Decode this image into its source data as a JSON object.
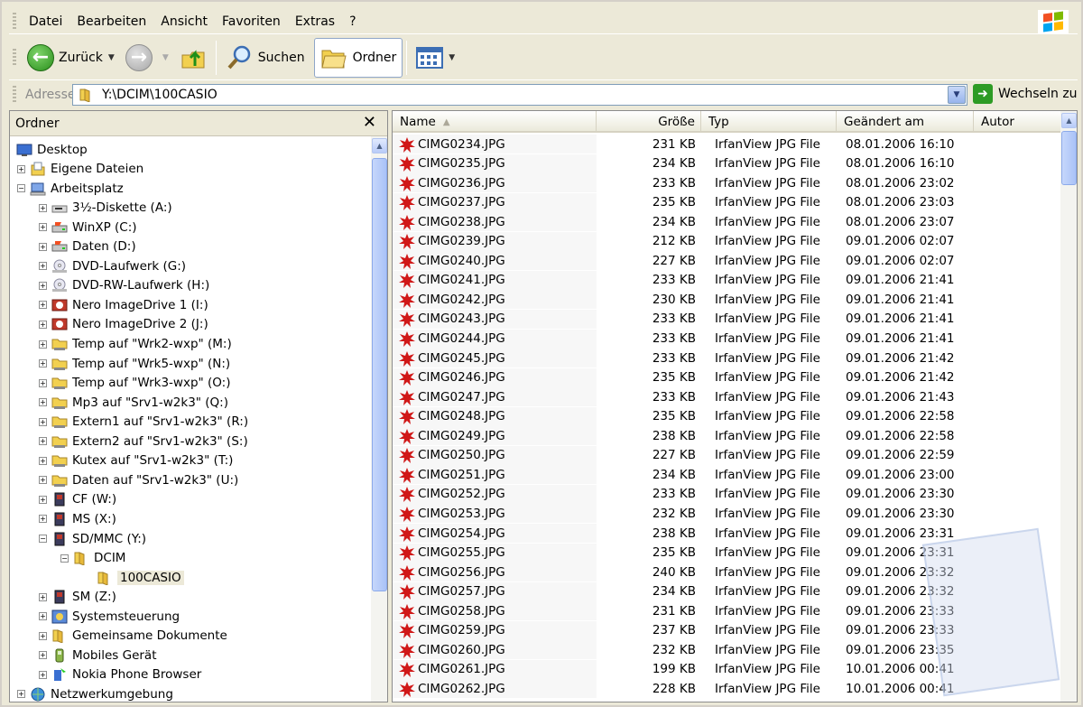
{
  "menu": [
    "Datei",
    "Bearbeiten",
    "Ansicht",
    "Favoriten",
    "Extras",
    "?"
  ],
  "toolbar": {
    "back": "Zurück",
    "search": "Suchen",
    "folders": "Ordner"
  },
  "address": {
    "label": "Adresse",
    "path": "Y:\\DCIM\\100CASIO",
    "go": "Wechseln zu"
  },
  "folderpane": {
    "title": "Ordner",
    "close": "✕"
  },
  "tree": [
    {
      "label": "Desktop",
      "level": 0,
      "expander": "",
      "icon": "desktop-icon"
    },
    {
      "label": "Eigene Dateien",
      "level": 1,
      "expander": "+",
      "icon": "my-documents-icon"
    },
    {
      "label": "Arbeitsplatz",
      "level": 1,
      "expander": "−",
      "icon": "my-computer-icon"
    },
    {
      "label": "3½-Diskette (A:)",
      "level": 2,
      "expander": "+",
      "icon": "floppy-drive-icon"
    },
    {
      "label": "WinXP (C:)",
      "level": 2,
      "expander": "+",
      "icon": "hard-drive-icon"
    },
    {
      "label": "Daten (D:)",
      "level": 2,
      "expander": "+",
      "icon": "hard-drive-icon"
    },
    {
      "label": "DVD-Laufwerk (G:)",
      "level": 2,
      "expander": "+",
      "icon": "dvd-drive-icon"
    },
    {
      "label": "DVD-RW-Laufwerk (H:)",
      "level": 2,
      "expander": "+",
      "icon": "dvd-drive-icon"
    },
    {
      "label": "Nero ImageDrive 1 (I:)",
      "level": 2,
      "expander": "+",
      "icon": "nero-drive-icon"
    },
    {
      "label": "Nero ImageDrive 2 (J:)",
      "level": 2,
      "expander": "+",
      "icon": "nero-drive-icon"
    },
    {
      "label": "Temp auf \"Wrk2-wxp\" (M:)",
      "level": 2,
      "expander": "+",
      "icon": "network-drive-icon"
    },
    {
      "label": "Temp auf \"Wrk5-wxp\" (N:)",
      "level": 2,
      "expander": "+",
      "icon": "network-drive-icon"
    },
    {
      "label": "Temp auf \"Wrk3-wxp\" (O:)",
      "level": 2,
      "expander": "+",
      "icon": "network-drive-icon"
    },
    {
      "label": "Mp3 auf \"Srv1-w2k3\" (Q:)",
      "level": 2,
      "expander": "+",
      "icon": "network-drive-icon"
    },
    {
      "label": "Extern1 auf \"Srv1-w2k3\" (R:)",
      "level": 2,
      "expander": "+",
      "icon": "network-drive-icon"
    },
    {
      "label": "Extern2 auf \"Srv1-w2k3\" (S:)",
      "level": 2,
      "expander": "+",
      "icon": "network-drive-icon"
    },
    {
      "label": "Kutex auf \"Srv1-w2k3\" (T:)",
      "level": 2,
      "expander": "+",
      "icon": "network-drive-icon"
    },
    {
      "label": "Daten auf \"Srv1-w2k3\" (U:)",
      "level": 2,
      "expander": "+",
      "icon": "network-drive-icon"
    },
    {
      "label": "CF (W:)",
      "level": 2,
      "expander": "+",
      "icon": "card-reader-icon"
    },
    {
      "label": "MS (X:)",
      "level": 2,
      "expander": "+",
      "icon": "card-reader-icon"
    },
    {
      "label": "SD/MMC (Y:)",
      "level": 2,
      "expander": "−",
      "icon": "card-reader-icon"
    },
    {
      "label": "DCIM",
      "level": 3,
      "expander": "−",
      "icon": "folder-icon"
    },
    {
      "label": "100CASIO",
      "level": 4,
      "expander": "",
      "icon": "folder-open-icon",
      "selected": true
    },
    {
      "label": "SM (Z:)",
      "level": 2,
      "expander": "+",
      "icon": "card-reader-icon"
    },
    {
      "label": "Systemsteuerung",
      "level": 2,
      "expander": "+",
      "icon": "control-panel-icon"
    },
    {
      "label": "Gemeinsame Dokumente",
      "level": 2,
      "expander": "+",
      "icon": "folder-icon"
    },
    {
      "label": "Mobiles Gerät",
      "level": 2,
      "expander": "+",
      "icon": "mobile-device-icon"
    },
    {
      "label": "Nokia Phone Browser",
      "level": 2,
      "expander": "+",
      "icon": "phone-browser-icon"
    },
    {
      "label": "Netzwerkumgebung",
      "level": 1,
      "expander": "+",
      "icon": "network-places-icon"
    }
  ],
  "columns": {
    "name": "Name",
    "size": "Größe",
    "type": "Typ",
    "modified": "Geändert am",
    "author": "Autor"
  },
  "files": [
    {
      "name": "CIMG0234.JPG",
      "size": "231 KB",
      "type": "IrfanView JPG File",
      "modified": "08.01.2006 16:10"
    },
    {
      "name": "CIMG0235.JPG",
      "size": "234 KB",
      "type": "IrfanView JPG File",
      "modified": "08.01.2006 16:10"
    },
    {
      "name": "CIMG0236.JPG",
      "size": "233 KB",
      "type": "IrfanView JPG File",
      "modified": "08.01.2006 23:02"
    },
    {
      "name": "CIMG0237.JPG",
      "size": "235 KB",
      "type": "IrfanView JPG File",
      "modified": "08.01.2006 23:03"
    },
    {
      "name": "CIMG0238.JPG",
      "size": "234 KB",
      "type": "IrfanView JPG File",
      "modified": "08.01.2006 23:07"
    },
    {
      "name": "CIMG0239.JPG",
      "size": "212 KB",
      "type": "IrfanView JPG File",
      "modified": "09.01.2006 02:07"
    },
    {
      "name": "CIMG0240.JPG",
      "size": "227 KB",
      "type": "IrfanView JPG File",
      "modified": "09.01.2006 02:07"
    },
    {
      "name": "CIMG0241.JPG",
      "size": "233 KB",
      "type": "IrfanView JPG File",
      "modified": "09.01.2006 21:41"
    },
    {
      "name": "CIMG0242.JPG",
      "size": "230 KB",
      "type": "IrfanView JPG File",
      "modified": "09.01.2006 21:41"
    },
    {
      "name": "CIMG0243.JPG",
      "size": "233 KB",
      "type": "IrfanView JPG File",
      "modified": "09.01.2006 21:41"
    },
    {
      "name": "CIMG0244.JPG",
      "size": "233 KB",
      "type": "IrfanView JPG File",
      "modified": "09.01.2006 21:41"
    },
    {
      "name": "CIMG0245.JPG",
      "size": "233 KB",
      "type": "IrfanView JPG File",
      "modified": "09.01.2006 21:42"
    },
    {
      "name": "CIMG0246.JPG",
      "size": "235 KB",
      "type": "IrfanView JPG File",
      "modified": "09.01.2006 21:42"
    },
    {
      "name": "CIMG0247.JPG",
      "size": "233 KB",
      "type": "IrfanView JPG File",
      "modified": "09.01.2006 21:43"
    },
    {
      "name": "CIMG0248.JPG",
      "size": "235 KB",
      "type": "IrfanView JPG File",
      "modified": "09.01.2006 22:58"
    },
    {
      "name": "CIMG0249.JPG",
      "size": "238 KB",
      "type": "IrfanView JPG File",
      "modified": "09.01.2006 22:58"
    },
    {
      "name": "CIMG0250.JPG",
      "size": "227 KB",
      "type": "IrfanView JPG File",
      "modified": "09.01.2006 22:59"
    },
    {
      "name": "CIMG0251.JPG",
      "size": "234 KB",
      "type": "IrfanView JPG File",
      "modified": "09.01.2006 23:00"
    },
    {
      "name": "CIMG0252.JPG",
      "size": "233 KB",
      "type": "IrfanView JPG File",
      "modified": "09.01.2006 23:30"
    },
    {
      "name": "CIMG0253.JPG",
      "size": "232 KB",
      "type": "IrfanView JPG File",
      "modified": "09.01.2006 23:30"
    },
    {
      "name": "CIMG0254.JPG",
      "size": "238 KB",
      "type": "IrfanView JPG File",
      "modified": "09.01.2006 23:31"
    },
    {
      "name": "CIMG0255.JPG",
      "size": "235 KB",
      "type": "IrfanView JPG File",
      "modified": "09.01.2006 23:31"
    },
    {
      "name": "CIMG0256.JPG",
      "size": "240 KB",
      "type": "IrfanView JPG File",
      "modified": "09.01.2006 23:32"
    },
    {
      "name": "CIMG0257.JPG",
      "size": "234 KB",
      "type": "IrfanView JPG File",
      "modified": "09.01.2006 23:32"
    },
    {
      "name": "CIMG0258.JPG",
      "size": "231 KB",
      "type": "IrfanView JPG File",
      "modified": "09.01.2006 23:33"
    },
    {
      "name": "CIMG0259.JPG",
      "size": "237 KB",
      "type": "IrfanView JPG File",
      "modified": "09.01.2006 23:33"
    },
    {
      "name": "CIMG0260.JPG",
      "size": "232 KB",
      "type": "IrfanView JPG File",
      "modified": "09.01.2006 23:35"
    },
    {
      "name": "CIMG0261.JPG",
      "size": "199 KB",
      "type": "IrfanView JPG File",
      "modified": "10.01.2006 00:41"
    },
    {
      "name": "CIMG0262.JPG",
      "size": "228 KB",
      "type": "IrfanView JPG File",
      "modified": "10.01.2006 00:41"
    }
  ],
  "colors": {
    "accent": "#316ac5",
    "window": "#ece9d8",
    "irfanview": "#d01818"
  }
}
